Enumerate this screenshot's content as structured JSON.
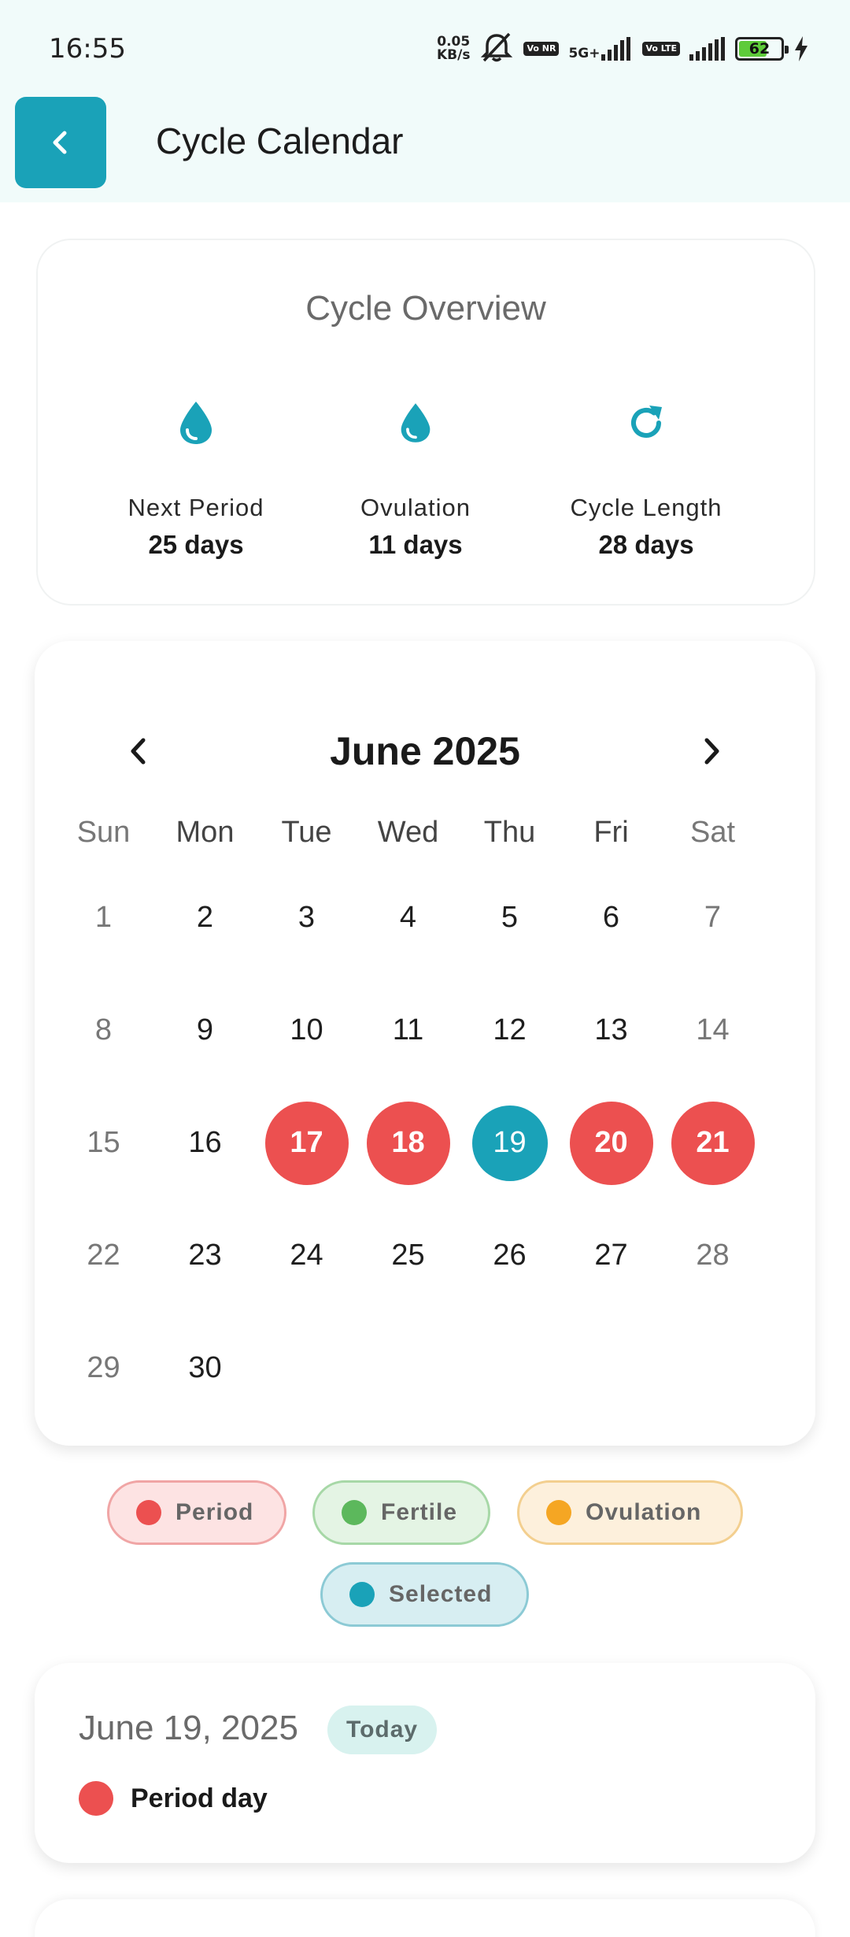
{
  "status_bar": {
    "time": "16:55",
    "net_speed_value": "0.05",
    "net_speed_unit": "KB/s",
    "badge_vonr": "Vo NR",
    "network_type": "5G+",
    "badge_volte": "Vo LTE",
    "battery_level": "62"
  },
  "app_bar": {
    "title": "Cycle Calendar",
    "back_icon": "chevron-left-icon"
  },
  "overview": {
    "title": "Cycle Overview",
    "stats": [
      {
        "icon": "drop-icon",
        "label": "Next Period",
        "value": "25 days"
      },
      {
        "icon": "drop-icon",
        "label": "Ovulation",
        "value": "11 days"
      },
      {
        "icon": "refresh-icon",
        "label": "Cycle Length",
        "value": "28 days"
      }
    ]
  },
  "calendar": {
    "month_title": "June 2025",
    "weekdays": [
      "Sun",
      "Mon",
      "Tue",
      "Wed",
      "Thu",
      "Fri",
      "Sat"
    ],
    "start_offset": 0,
    "days_in_month": 30,
    "period_days": [
      17,
      18,
      20,
      21
    ],
    "selected_day": 19
  },
  "legend": [
    {
      "label": "Period",
      "color": "#ec5050",
      "bg": "#fde3e3",
      "border": "#f0a5a5"
    },
    {
      "label": "Fertile",
      "color": "#5cb85c",
      "bg": "#e4f4e4",
      "border": "#a7d8a7"
    },
    {
      "label": "Ovulation",
      "color": "#f5a623",
      "bg": "#fdf0dc",
      "border": "#f3cf8f"
    },
    {
      "label": "Selected",
      "color": "#1aa2b8",
      "bg": "#d7eef2",
      "border": "#8ccad5"
    }
  ],
  "selected_info": {
    "date": "June 19, 2025",
    "badge": "Today",
    "status": "Period day",
    "status_color": "#ec5050"
  },
  "colors": {
    "accent": "#1aa2b8",
    "period": "#ec5050"
  }
}
